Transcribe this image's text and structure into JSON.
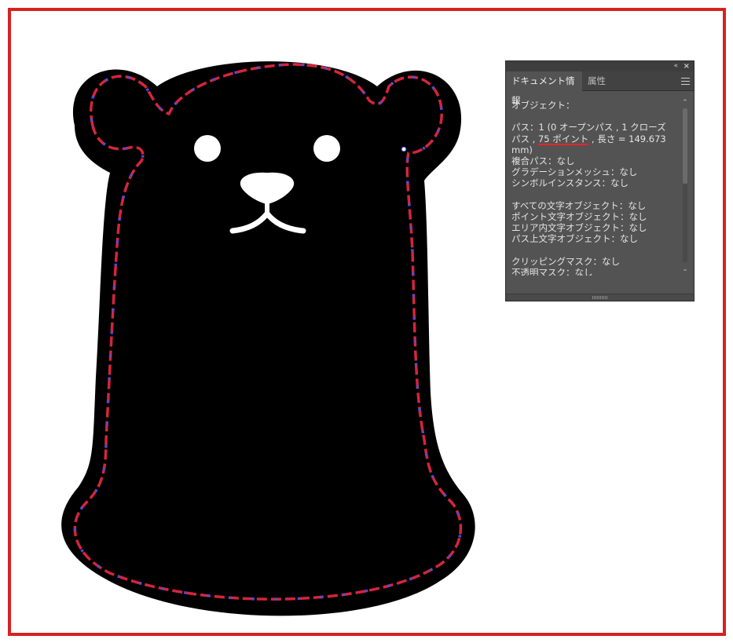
{
  "panel": {
    "collapse_icon": "«",
    "close_icon": "×",
    "tabs": [
      {
        "label": "ドキュメント情報",
        "active": true
      },
      {
        "label": "属性",
        "active": false
      }
    ],
    "menu_icon": "panel-menu-icon",
    "content": {
      "line1": "オブジェクト：",
      "path_prefix": "パス：1 (0 オープンパス , 1 クローズ",
      "path_line2_pre": "パス , ",
      "path_points": "75 ポイント",
      "path_line2_post": " , 長さ = 149.673",
      "path_line3": "mm)",
      "compound": "複合パス：なし",
      "gradient": "グラデーションメッシュ：なし",
      "symbol": "シンボルインスタンス：なし",
      "all_text": "すべての文字オブジェクト：なし",
      "point_text": "ポイント文字オブジェクト：なし",
      "area_text": "エリア内文字オブジェクト：なし",
      "path_text": "パス上文字オブジェクト：なし",
      "clip": "クリッピングマスク：なし",
      "opacity_mask": "不透明マスク：なし"
    },
    "scroll_up_icon": "⌃",
    "scroll_down_icon": "⌄"
  },
  "colors": {
    "frame": "#d42320",
    "path_highlight": "#d4253c",
    "anchor_point": "#4a4fe0",
    "panel_bg": "#535353",
    "annotation_underline": "#e8242a"
  }
}
